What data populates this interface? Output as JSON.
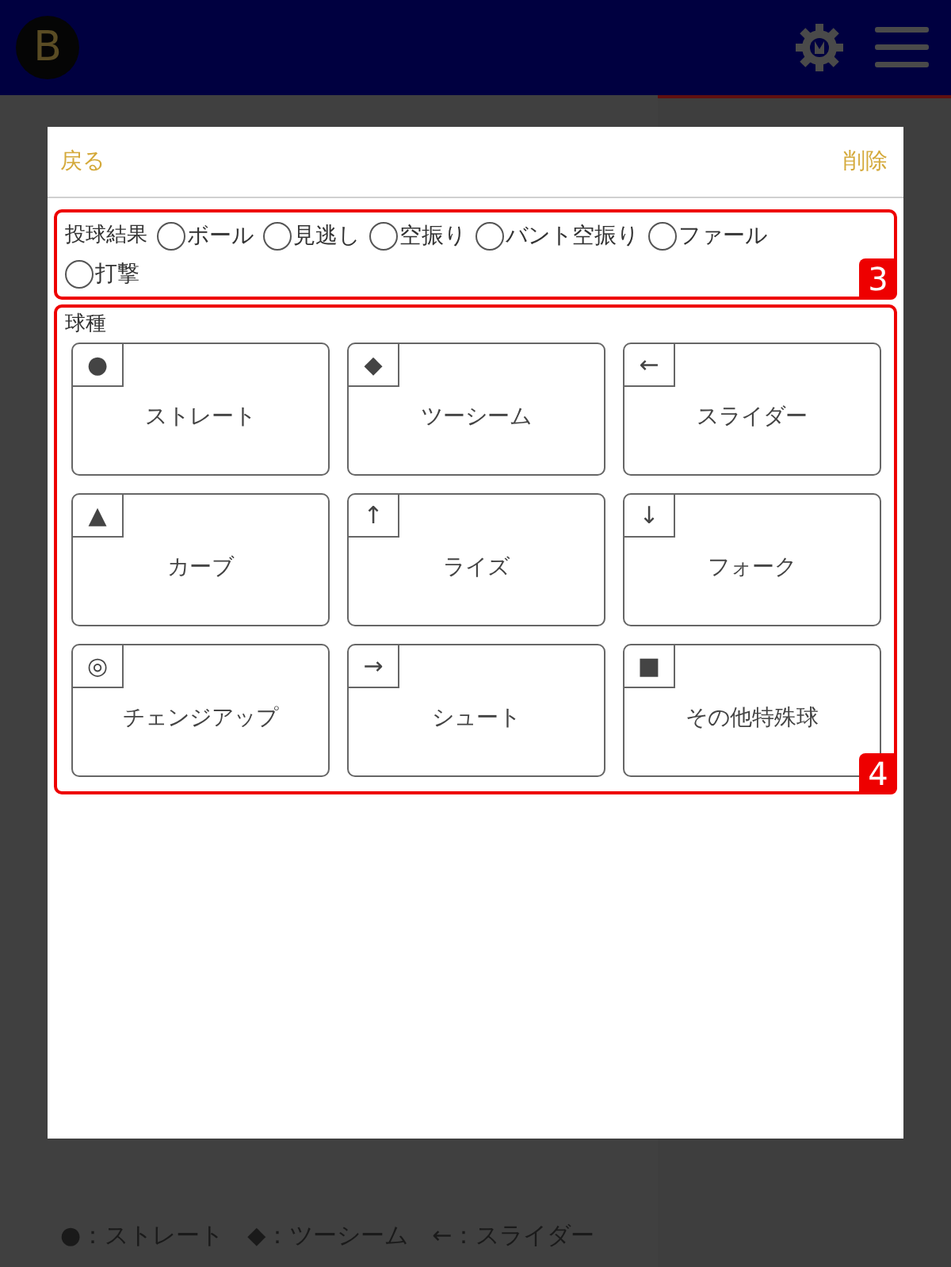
{
  "header": {
    "logo": "B"
  },
  "modal": {
    "back": "戻る",
    "delete": "削除",
    "result": {
      "label": "投球結果",
      "badge": "3",
      "options": [
        {
          "label": "ボール",
          "selected": false
        },
        {
          "label": "見逃し",
          "selected": false
        },
        {
          "label": "空振り",
          "selected": false
        },
        {
          "label": "バント空振り",
          "selected": false
        },
        {
          "label": "ファール",
          "selected": false
        },
        {
          "label": "打撃",
          "selected": false
        }
      ]
    },
    "pitch_types": {
      "label": "球種",
      "badge": "4",
      "items": [
        {
          "mark": "●",
          "label": "ストレート",
          "selected": false
        },
        {
          "mark": "◆",
          "label": "ツーシーム",
          "selected": false
        },
        {
          "mark": "←",
          "label": "スライダー",
          "selected": false
        },
        {
          "mark": "▲",
          "label": "カーブ",
          "selected": false
        },
        {
          "mark": "↑",
          "label": "ライズ",
          "selected": false
        },
        {
          "mark": "↓",
          "label": "フォーク",
          "selected": false
        },
        {
          "mark": "◎",
          "label": "チェンジアップ",
          "selected": false
        },
        {
          "mark": "→",
          "label": "シュート",
          "selected": false
        },
        {
          "mark": "■",
          "label": "その他特殊球",
          "selected": false
        }
      ]
    }
  },
  "legend": "●：ストレート　◆：ツーシーム　←：スライダー"
}
